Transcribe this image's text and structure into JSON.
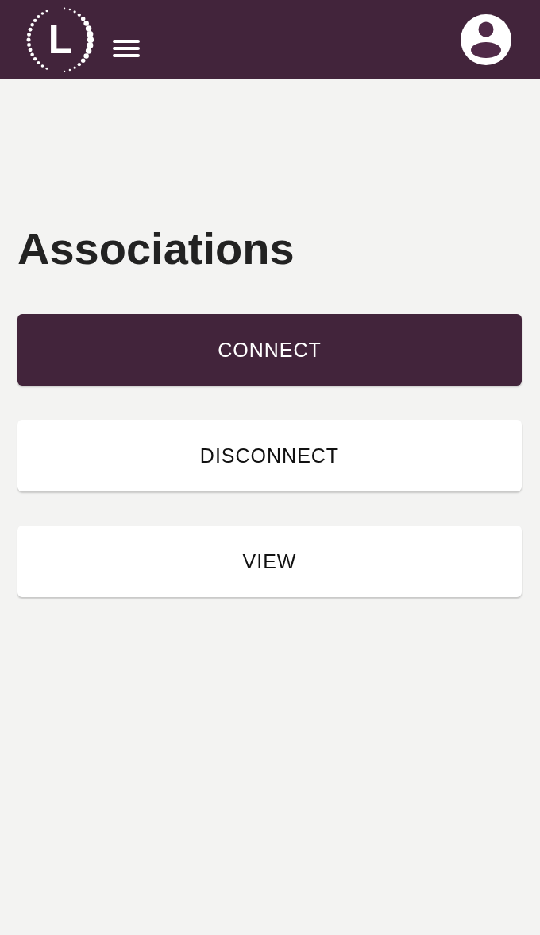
{
  "header": {
    "logo_letter": "L"
  },
  "page_title": "Associations",
  "buttons": [
    {
      "label": "CONNECT",
      "kind": "primary"
    },
    {
      "label": "DISCONNECT",
      "kind": "secondary"
    },
    {
      "label": "VIEW",
      "kind": "secondary"
    }
  ]
}
